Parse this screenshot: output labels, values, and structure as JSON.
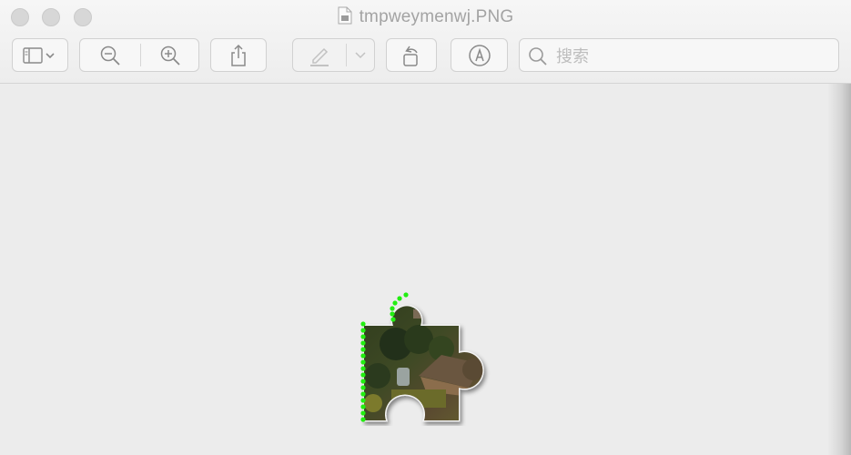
{
  "window": {
    "title": "tmpweymenwj.PNG"
  },
  "toolbar": {
    "search": {
      "placeholder": "搜索",
      "value": ""
    }
  },
  "icons": {
    "document": "document-icon",
    "sidebar": "sidebar-icon",
    "zoom_out": "zoom-out-icon",
    "zoom_in": "zoom-in-icon",
    "share": "share-icon",
    "highlight": "highlighter-icon",
    "rotate": "rotate-icon",
    "markup": "markup-pen-icon",
    "search": "search-icon"
  },
  "colors": {
    "outline_green": "#22ee11",
    "traffic_light_inactive": "#d7d7d7"
  }
}
